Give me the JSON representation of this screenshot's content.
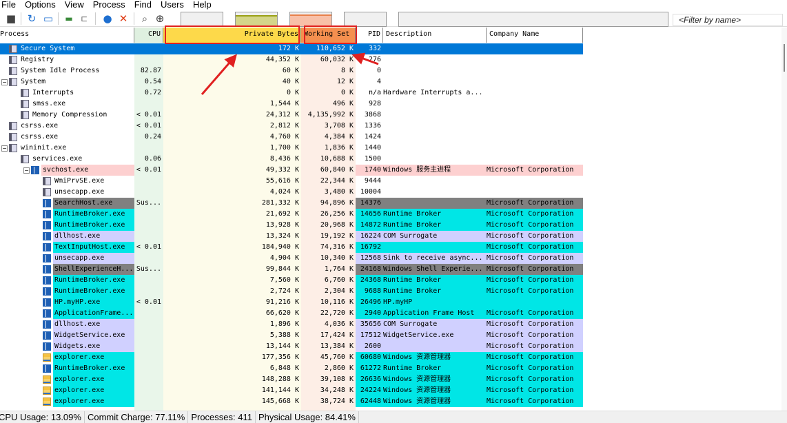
{
  "menu": [
    "File",
    "Options",
    "View",
    "Process",
    "Find",
    "Users",
    "Help"
  ],
  "filter_placeholder": "<Filter by name>",
  "columns": {
    "process": "Process",
    "cpu": "CPU",
    "private": "Private Bytes",
    "working": "Working Set",
    "pid": "PID",
    "desc": "Description",
    "company": "Company Name"
  },
  "colors": {
    "selected": "#0078d7",
    "service": "#fdd0d0",
    "immersive": "#00e6e6",
    "suspended": "#808080",
    "packed": "#d0d0ff",
    "annotation": "#e02020"
  },
  "rows": [
    {
      "name": "Secure System",
      "lvl": 0,
      "ico": "gen",
      "cpu": "",
      "pb": "172 K",
      "ws": "110,652 K",
      "pid": "332",
      "desc": "",
      "co": "",
      "cls": "selected"
    },
    {
      "name": "Registry",
      "lvl": 0,
      "ico": "gen",
      "cpu": "",
      "pb": "44,352 K",
      "ws": "60,032 K",
      "pid": "276",
      "desc": "",
      "co": "",
      "cls": ""
    },
    {
      "name": "System Idle Process",
      "lvl": 0,
      "ico": "gen",
      "cpu": "82.87",
      "pb": "60 K",
      "ws": "8 K",
      "pid": "0",
      "desc": "",
      "co": "",
      "cls": ""
    },
    {
      "name": "System",
      "lvl": 0,
      "ico": "gen",
      "exp": true,
      "cpu": "0.54",
      "pb": "40 K",
      "ws": "12 K",
      "pid": "4",
      "desc": "",
      "co": "",
      "cls": ""
    },
    {
      "name": "Interrupts",
      "lvl": 1,
      "ico": "gen",
      "cpu": "0.72",
      "pb": "0 K",
      "ws": "0 K",
      "pid": "n/a",
      "desc": "Hardware Interrupts a...",
      "co": "",
      "cls": ""
    },
    {
      "name": "smss.exe",
      "lvl": 1,
      "ico": "gen",
      "cpu": "",
      "pb": "1,544 K",
      "ws": "496 K",
      "pid": "928",
      "desc": "",
      "co": "",
      "cls": ""
    },
    {
      "name": "Memory Compression",
      "lvl": 1,
      "ico": "gen",
      "cpu": "< 0.01",
      "pb": "24,312 K",
      "ws": "4,135,992 K",
      "pid": "3868",
      "desc": "",
      "co": "",
      "cls": ""
    },
    {
      "name": "csrss.exe",
      "lvl": 0,
      "ico": "gen",
      "cpu": "< 0.01",
      "pb": "2,812 K",
      "ws": "3,708 K",
      "pid": "1336",
      "desc": "",
      "co": "",
      "cls": ""
    },
    {
      "name": "csrss.exe",
      "lvl": 0,
      "ico": "gen",
      "cpu": "0.24",
      "pb": "4,760 K",
      "ws": "4,384 K",
      "pid": "1424",
      "desc": "",
      "co": "",
      "cls": ""
    },
    {
      "name": "wininit.exe",
      "lvl": 0,
      "ico": "gen",
      "exp": true,
      "cpu": "",
      "pb": "1,700 K",
      "ws": "1,836 K",
      "pid": "1440",
      "desc": "",
      "co": "",
      "cls": ""
    },
    {
      "name": "services.exe",
      "lvl": 1,
      "ico": "gen",
      "cpu": "0.06",
      "pb": "8,436 K",
      "ws": "10,688 K",
      "pid": "1500",
      "desc": "",
      "co": "",
      "cls": ""
    },
    {
      "name": "svchost.exe",
      "lvl": 2,
      "ico": "svc",
      "exp": true,
      "cpu": "< 0.01",
      "pb": "49,332 K",
      "ws": "60,840 K",
      "pid": "1740",
      "desc": "Windows 服务主进程",
      "co": "Microsoft Corporation",
      "cls": "service"
    },
    {
      "name": "WmiPrvSE.exe",
      "lvl": 3,
      "ico": "gen",
      "cpu": "",
      "pb": "55,616 K",
      "ws": "22,344 K",
      "pid": "9444",
      "desc": "",
      "co": "",
      "cls": ""
    },
    {
      "name": "unsecapp.exe",
      "lvl": 3,
      "ico": "gen",
      "cpu": "",
      "pb": "4,024 K",
      "ws": "3,480 K",
      "pid": "10004",
      "desc": "",
      "co": "",
      "cls": ""
    },
    {
      "name": "SearchHost.exe",
      "lvl": 3,
      "ico": "svc",
      "cpu": "Sus...",
      "pb": "281,332 K",
      "ws": "94,896 K",
      "pid": "14376",
      "desc": "",
      "co": "Microsoft Corporation",
      "cls": "suspended"
    },
    {
      "name": "RuntimeBroker.exe",
      "lvl": 3,
      "ico": "svc",
      "cpu": "",
      "pb": "21,692 K",
      "ws": "26,256 K",
      "pid": "14656",
      "desc": "Runtime Broker",
      "co": "Microsoft Corporation",
      "cls": "immersive"
    },
    {
      "name": "RuntimeBroker.exe",
      "lvl": 3,
      "ico": "svc",
      "cpu": "",
      "pb": "13,928 K",
      "ws": "20,968 K",
      "pid": "14872",
      "desc": "Runtime Broker",
      "co": "Microsoft Corporation",
      "cls": "immersive"
    },
    {
      "name": "dllhost.exe",
      "lvl": 3,
      "ico": "svc",
      "cpu": "",
      "pb": "13,324 K",
      "ws": "19,192 K",
      "pid": "16224",
      "desc": "COM Surrogate",
      "co": "Microsoft Corporation",
      "cls": "packed"
    },
    {
      "name": "TextInputHost.exe",
      "lvl": 3,
      "ico": "svc",
      "cpu": "< 0.01",
      "pb": "184,940 K",
      "ws": "74,316 K",
      "pid": "16792",
      "desc": "",
      "co": "Microsoft Corporation",
      "cls": "immersive"
    },
    {
      "name": "unsecapp.exe",
      "lvl": 3,
      "ico": "svc",
      "cpu": "",
      "pb": "4,904 K",
      "ws": "10,340 K",
      "pid": "12568",
      "desc": "Sink to receive async...",
      "co": "Microsoft Corporation",
      "cls": "packed"
    },
    {
      "name": "ShellExperienceH...",
      "lvl": 3,
      "ico": "svc",
      "cpu": "Sus...",
      "pb": "99,844 K",
      "ws": "1,764 K",
      "pid": "24168",
      "desc": "Windows Shell Experie...",
      "co": "Microsoft Corporation",
      "cls": "suspended"
    },
    {
      "name": "RuntimeBroker.exe",
      "lvl": 3,
      "ico": "svc",
      "cpu": "",
      "pb": "7,560 K",
      "ws": "6,760 K",
      "pid": "24368",
      "desc": "Runtime Broker",
      "co": "Microsoft Corporation",
      "cls": "immersive"
    },
    {
      "name": "RuntimeBroker.exe",
      "lvl": 3,
      "ico": "svc",
      "cpu": "",
      "pb": "2,724 K",
      "ws": "2,304 K",
      "pid": "9688",
      "desc": "Runtime Broker",
      "co": "Microsoft Corporation",
      "cls": "immersive"
    },
    {
      "name": "HP.myHP.exe",
      "lvl": 3,
      "ico": "svc",
      "cpu": "< 0.01",
      "pb": "91,216 K",
      "ws": "10,116 K",
      "pid": "26496",
      "desc": "HP.myHP",
      "co": "",
      "cls": "immersive"
    },
    {
      "name": "ApplicationFrame...",
      "lvl": 3,
      "ico": "svc",
      "cpu": "",
      "pb": "66,620 K",
      "ws": "22,720 K",
      "pid": "2940",
      "desc": "Application Frame Host",
      "co": "Microsoft Corporation",
      "cls": "immersive"
    },
    {
      "name": "dllhost.exe",
      "lvl": 3,
      "ico": "svc",
      "cpu": "",
      "pb": "1,896 K",
      "ws": "4,036 K",
      "pid": "35656",
      "desc": "COM Surrogate",
      "co": "Microsoft Corporation",
      "cls": "packed"
    },
    {
      "name": "WidgetService.exe",
      "lvl": 3,
      "ico": "svc",
      "cpu": "",
      "pb": "5,388 K",
      "ws": "17,424 K",
      "pid": "17512",
      "desc": "WidgetService.exe",
      "co": "Microsoft Corporation",
      "cls": "packed"
    },
    {
      "name": "Widgets.exe",
      "lvl": 3,
      "ico": "svc",
      "cpu": "",
      "pb": "13,144 K",
      "ws": "13,384 K",
      "pid": "2600",
      "desc": "",
      "co": "Microsoft Corporation",
      "cls": "packed"
    },
    {
      "name": "explorer.exe",
      "lvl": 3,
      "ico": "fold",
      "cpu": "",
      "pb": "177,356 K",
      "ws": "45,760 K",
      "pid": "60680",
      "desc": "Windows 资源管理器",
      "co": "Microsoft Corporation",
      "cls": "immersive"
    },
    {
      "name": "RuntimeBroker.exe",
      "lvl": 3,
      "ico": "svc",
      "cpu": "",
      "pb": "6,848 K",
      "ws": "2,860 K",
      "pid": "61272",
      "desc": "Runtime Broker",
      "co": "Microsoft Corporation",
      "cls": "immersive"
    },
    {
      "name": "explorer.exe",
      "lvl": 3,
      "ico": "fold",
      "cpu": "",
      "pb": "148,288 K",
      "ws": "39,108 K",
      "pid": "26636",
      "desc": "Windows 资源管理器",
      "co": "Microsoft Corporation",
      "cls": "immersive"
    },
    {
      "name": "explorer.exe",
      "lvl": 3,
      "ico": "fold",
      "cpu": "",
      "pb": "141,144 K",
      "ws": "34,248 K",
      "pid": "24224",
      "desc": "Windows 资源管理器",
      "co": "Microsoft Corporation",
      "cls": "immersive"
    },
    {
      "name": "explorer.exe",
      "lvl": 3,
      "ico": "fold",
      "cpu": "",
      "pb": "145,668 K",
      "ws": "38,724 K",
      "pid": "62448",
      "desc": "Windows 资源管理器",
      "co": "Microsoft Corporation",
      "cls": "immersive"
    }
  ],
  "status": {
    "cpu": "CPU Usage: 13.09%",
    "commit": "Commit Charge: 77.11%",
    "processes": "Processes: 411",
    "physical": "Physical Usage: 84.41%"
  }
}
